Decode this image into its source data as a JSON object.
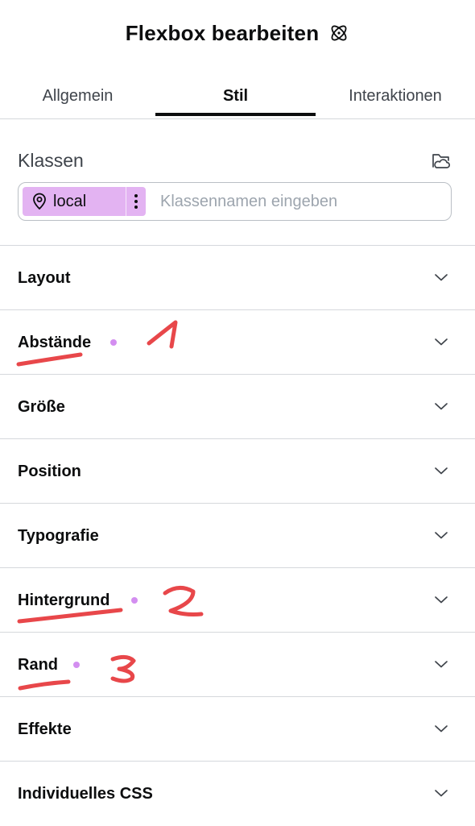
{
  "header": {
    "title": "Flexbox bearbeiten",
    "icon": "atom-icon"
  },
  "tabs": [
    {
      "label": "Allgemein",
      "active": false
    },
    {
      "label": "Stil",
      "active": true
    },
    {
      "label": "Interaktionen",
      "active": false
    }
  ],
  "classes": {
    "label": "Klassen",
    "manager_icon": "folder-cloud-icon",
    "chip": {
      "label": "local",
      "icon": "map-pin-icon",
      "color": "#e3b3f2"
    },
    "input_placeholder": "Klassennamen eingeben",
    "input_value": ""
  },
  "sections": [
    {
      "label": "Layout",
      "modified": false
    },
    {
      "label": "Abstände",
      "modified": true
    },
    {
      "label": "Größe",
      "modified": false
    },
    {
      "label": "Position",
      "modified": false
    },
    {
      "label": "Typografie",
      "modified": false
    },
    {
      "label": "Hintergrund",
      "modified": true
    },
    {
      "label": "Rand",
      "modified": true
    },
    {
      "label": "Effekte",
      "modified": false
    },
    {
      "label": "Individuelles CSS",
      "modified": false
    }
  ],
  "annotations": {
    "color": "#e8474a",
    "numbers": [
      "1",
      "2",
      "3"
    ]
  },
  "colors": {
    "accent_dot": "#d38ef0",
    "active_tab": "#0c0d0e"
  }
}
